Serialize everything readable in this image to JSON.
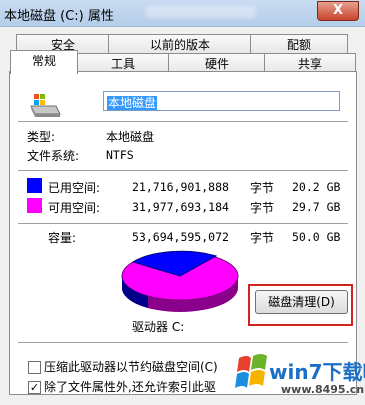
{
  "window": {
    "title": "本地磁盘 (C:) 属性",
    "close_label": "X"
  },
  "tabs_back": [
    {
      "label": "安全"
    },
    {
      "label": "以前的版本"
    },
    {
      "label": "配额"
    }
  ],
  "tabs_front": [
    {
      "label": "常规",
      "active": true
    },
    {
      "label": "工具"
    },
    {
      "label": "硬件"
    },
    {
      "label": "共享"
    }
  ],
  "general": {
    "drive_icon": "hard-drive-icon",
    "name_value": "本地磁盘",
    "type_label": "类型:",
    "type_value": "本地磁盘",
    "fs_label": "文件系统:",
    "fs_value": "NTFS",
    "used": {
      "label": "已用空间:",
      "bytes": "21,716,901,888",
      "unit": "字节",
      "size": "20.2 GB",
      "color": "#0000ff"
    },
    "free": {
      "label": "可用空间:",
      "bytes": "31,977,693,184",
      "unit": "字节",
      "size": "29.7 GB",
      "color": "#ff00ff"
    },
    "capacity": {
      "label": "容量:",
      "bytes": "53,694,595,072",
      "unit": "字节",
      "size": "50.0 GB"
    },
    "drive_label": "驱动器 C:",
    "cleanup_button": "磁盘清理(D)",
    "compress_checkbox": {
      "label": "压缩此驱动器以节约磁盘空间(C)",
      "checked": false
    },
    "index_checkbox": {
      "label": "除了文件属性外,还允许索引此驱",
      "checked": true
    }
  },
  "watermark": {
    "brand": "win7下载吧",
    "url": "www.8495.cn"
  }
}
